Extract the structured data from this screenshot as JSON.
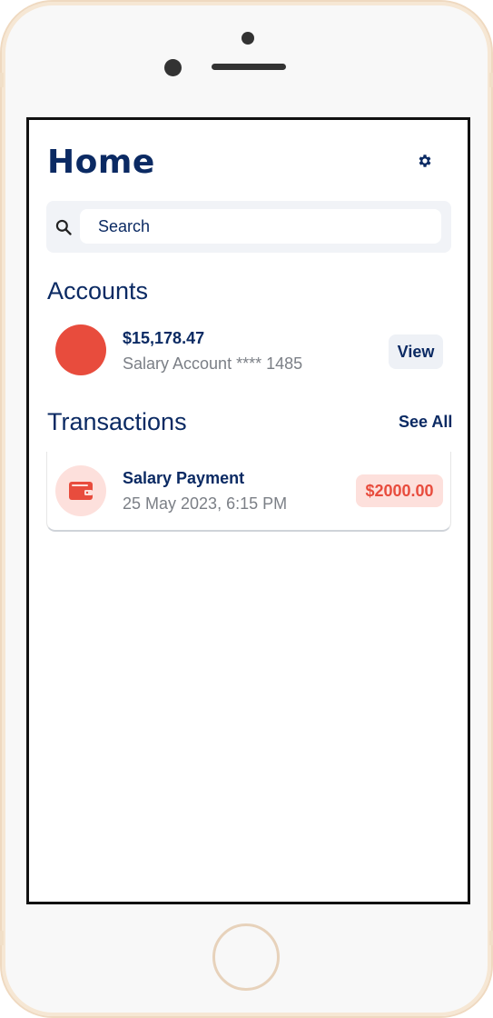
{
  "header": {
    "title": "Home",
    "settings_icon": "gear-icon"
  },
  "search": {
    "placeholder": "Search",
    "value": "",
    "icon": "search-icon"
  },
  "accounts": {
    "section_title": "Accounts",
    "items": [
      {
        "balance": "$15,178.47",
        "label": "Salary Account **** 1485",
        "action_label": "View",
        "avatar_color": "#e84c3d"
      }
    ]
  },
  "transactions": {
    "section_title": "Transactions",
    "see_all_label": "See All",
    "items": [
      {
        "title": "Salary Payment",
        "datetime": "25 May 2023, 6:15 PM",
        "amount": "$2000.00",
        "icon": "wallet-icon"
      }
    ]
  },
  "colors": {
    "primary": "#0b2a63",
    "accent": "#e84c3d",
    "accent_light": "#fde0dc",
    "muted_text": "#7b7f86",
    "surface": "#f1f3f7"
  }
}
